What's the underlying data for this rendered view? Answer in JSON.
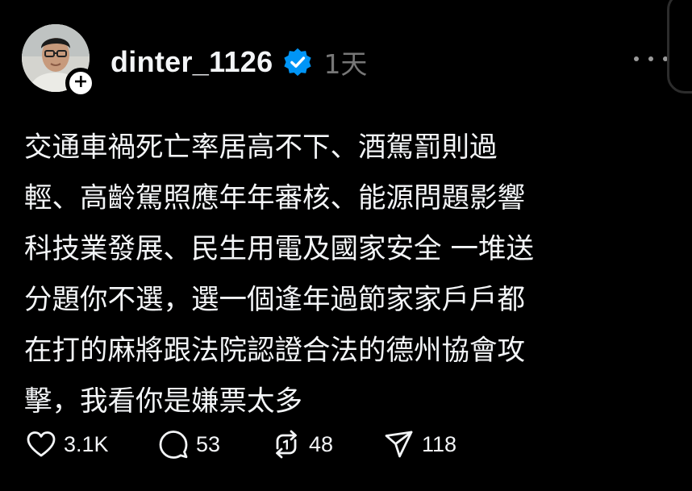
{
  "post": {
    "username": "dinter_1126",
    "time": "1天",
    "text_lines": [
      "交通車禍死亡率居高不下、酒駕罰則過",
      "輕、高齡駕照應年年審核、能源問題影響",
      "科技業發展、民生用電及國家安全 一堆送",
      "分題你不選，選一個逢年過節家家戶戶都",
      "在打的麻將跟法院認證合法的德州協會攻",
      "擊，我看你是嫌票太多"
    ],
    "actions": {
      "likes": "3.1K",
      "replies": "53",
      "reposts": "48",
      "shares": "118"
    }
  },
  "icons": {
    "verified": "verified-badge-icon",
    "follow": "plus-icon",
    "more": "more-dots-icon",
    "like": "heart-icon",
    "reply": "comment-bubble-icon",
    "repost": "repost-icon",
    "share": "send-icon"
  },
  "colors": {
    "background": "#000000",
    "text": "#f3f5f7",
    "muted": "#777777",
    "verified_blue": "#0095f6"
  }
}
